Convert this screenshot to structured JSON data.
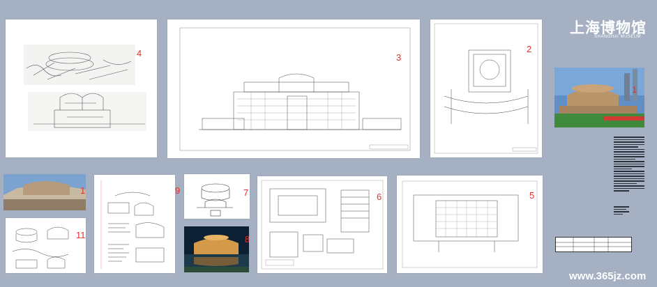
{
  "board": {
    "title": "上海博物馆",
    "subtitle": "SHANGHAI MUSEUM",
    "watermark": "www.365jz.com"
  },
  "panels": [
    {
      "number": "1",
      "type": "photo"
    },
    {
      "number": "2",
      "type": "site-plan"
    },
    {
      "number": "3",
      "type": "elevation"
    },
    {
      "number": "4",
      "type": "sketches"
    },
    {
      "number": "5",
      "type": "floor-plan"
    },
    {
      "number": "6",
      "type": "detail-drawings"
    },
    {
      "number": "7",
      "type": "sketch"
    },
    {
      "number": "8",
      "type": "night-photo"
    },
    {
      "number": "9",
      "type": "sketchbook"
    },
    {
      "number": "10",
      "type": "photo"
    },
    {
      "number": "11",
      "type": "sketches"
    }
  ],
  "colors": {
    "background": "#a5b0c2",
    "numbers": "#e5312b"
  }
}
